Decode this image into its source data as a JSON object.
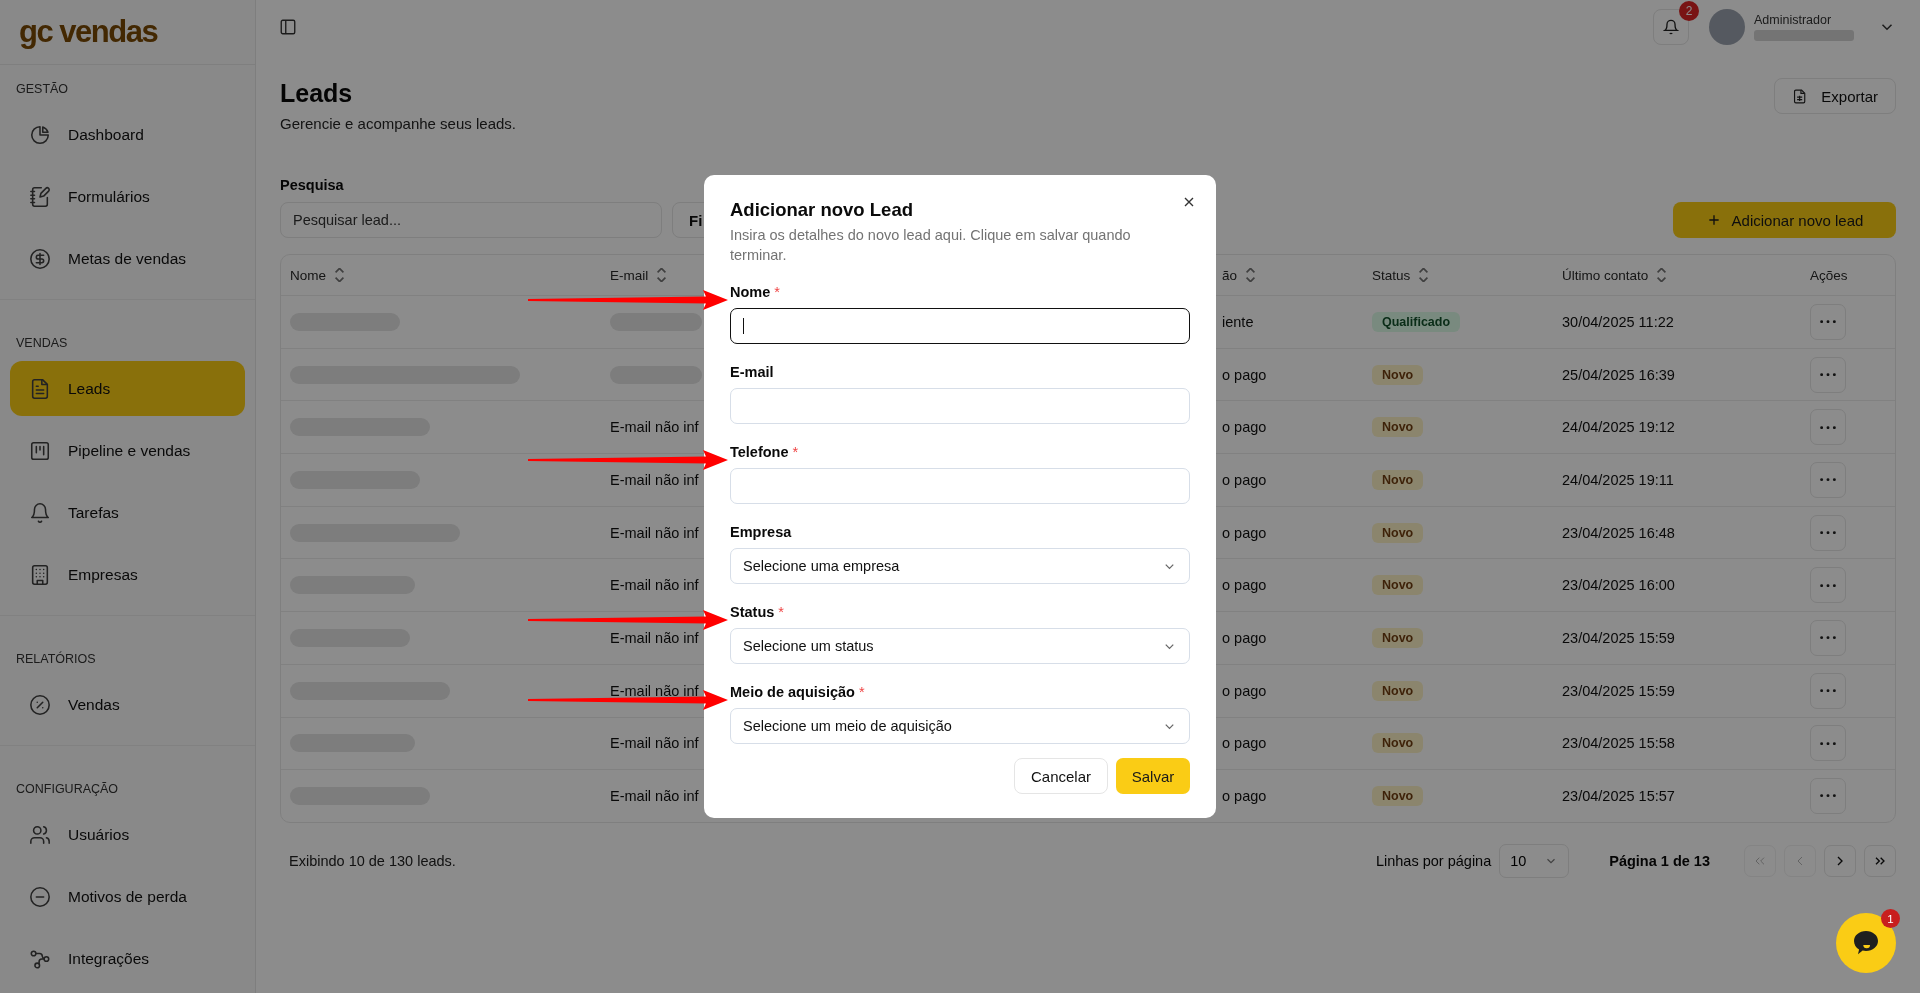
{
  "sidebar": {
    "logo": "gc vendas",
    "sections": [
      {
        "title": "GESTÃO",
        "items": [
          {
            "label": "Dashboard",
            "selected": false
          },
          {
            "label": "Formulários",
            "selected": false
          },
          {
            "label": "Metas de vendas",
            "selected": false
          }
        ]
      },
      {
        "title": "VENDAS",
        "items": [
          {
            "label": "Leads",
            "selected": true
          },
          {
            "label": "Pipeline e vendas",
            "selected": false
          },
          {
            "label": "Tarefas",
            "selected": false
          },
          {
            "label": "Empresas",
            "selected": false
          }
        ]
      },
      {
        "title": "RELATÓRIOS",
        "items": [
          {
            "label": "Vendas",
            "selected": false
          }
        ]
      },
      {
        "title": "CONFIGURAÇÃO",
        "items": [
          {
            "label": "Usuários",
            "selected": false
          },
          {
            "label": "Motivos de perda",
            "selected": false
          },
          {
            "label": "Integrações",
            "selected": false
          }
        ]
      }
    ]
  },
  "topbar": {
    "notification_count": "2",
    "user_role": "Administrador"
  },
  "page": {
    "title": "Leads",
    "subtitle": "Gerencie e acompanhe seus leads.",
    "export_button": "Exportar",
    "search": {
      "label": "Pesquisa",
      "placeholder": "Pesquisar lead..."
    },
    "filter_button": "Fi",
    "add_button": "Adicionar novo lead"
  },
  "table": {
    "columns": [
      {
        "label": "Nome",
        "sortable": true
      },
      {
        "label": "E-mail",
        "sortable": true
      },
      {
        "label": "ão",
        "sortable": true
      },
      {
        "label": "Status",
        "sortable": true
      },
      {
        "label": "Último contato",
        "sortable": true
      },
      {
        "label": "Ações",
        "sortable": false
      }
    ],
    "rows": [
      {
        "email_redacted": true,
        "column_3": "iente",
        "status": {
          "label": "Qualificado",
          "kind": "qualified"
        },
        "last_contact": "30/04/2025 11:22"
      },
      {
        "email_redacted": true,
        "column_3": "o pago",
        "status": {
          "label": "Novo",
          "kind": "new"
        },
        "last_contact": "25/04/2025 16:39"
      },
      {
        "email_redacted": false,
        "email": "E-mail não inf",
        "column_3": "o pago",
        "status": {
          "label": "Novo",
          "kind": "new"
        },
        "last_contact": "24/04/2025 19:12"
      },
      {
        "email_redacted": false,
        "email": "E-mail não inf",
        "column_3": "o pago",
        "status": {
          "label": "Novo",
          "kind": "new"
        },
        "last_contact": "24/04/2025 19:11"
      },
      {
        "email_redacted": false,
        "email": "E-mail não inf",
        "column_3": "o pago",
        "status": {
          "label": "Novo",
          "kind": "new"
        },
        "last_contact": "23/04/2025 16:48"
      },
      {
        "email_redacted": false,
        "email": "E-mail não inf",
        "column_3": "o pago",
        "status": {
          "label": "Novo",
          "kind": "new"
        },
        "last_contact": "23/04/2025 16:00"
      },
      {
        "email_redacted": false,
        "email": "E-mail não inf",
        "column_3": "o pago",
        "status": {
          "label": "Novo",
          "kind": "new"
        },
        "last_contact": "23/04/2025 15:59"
      },
      {
        "email_redacted": false,
        "email": "E-mail não inf",
        "column_3": "o pago",
        "status": {
          "label": "Novo",
          "kind": "new"
        },
        "last_contact": "23/04/2025 15:59"
      },
      {
        "email_redacted": false,
        "email": "E-mail não inf",
        "column_3": "o pago",
        "status": {
          "label": "Novo",
          "kind": "new"
        },
        "last_contact": "23/04/2025 15:58"
      },
      {
        "email_redacted": false,
        "email": "E-mail não inf",
        "column_3": "o pago",
        "status": {
          "label": "Novo",
          "kind": "new"
        },
        "last_contact": "23/04/2025 15:57"
      }
    ]
  },
  "pagination": {
    "summary": "Exibindo 10 de 130 leads.",
    "rows_label": "Linhas por página",
    "rows_per_page": "10",
    "page_label": "Página 1 de 13",
    "buttons": [
      {
        "kind": "first",
        "disabled": true
      },
      {
        "kind": "previous",
        "disabled": true
      },
      {
        "kind": "next",
        "disabled": false
      },
      {
        "kind": "last",
        "disabled": false
      }
    ]
  },
  "modal": {
    "title": "Adicionar novo Lead",
    "description": "Insira os detalhes do novo lead aqui. Clique em salvar quando terminar.",
    "required_mark": "*",
    "fields": [
      {
        "kind": "text",
        "label": "Nome",
        "required": true,
        "focused": true,
        "arrow": true
      },
      {
        "kind": "text",
        "label": "E-mail",
        "required": false,
        "focused": false,
        "arrow": false
      },
      {
        "kind": "text",
        "label": "Telefone",
        "required": true,
        "focused": false,
        "arrow": true
      },
      {
        "kind": "select",
        "label": "Empresa",
        "required": false,
        "focused": false,
        "placeholder": "Selecione uma empresa",
        "arrow": false
      },
      {
        "kind": "select",
        "label": "Status",
        "required": true,
        "focused": false,
        "placeholder": "Selecione um status",
        "arrow": true
      },
      {
        "kind": "select",
        "label": "Meio de aquisição",
        "required": true,
        "focused": false,
        "placeholder": "Selecione um meio de aquisição",
        "arrow": true
      }
    ],
    "cancel_button": "Cancelar",
    "save_button": "Salvar"
  },
  "chat": {
    "badge": "1"
  }
}
